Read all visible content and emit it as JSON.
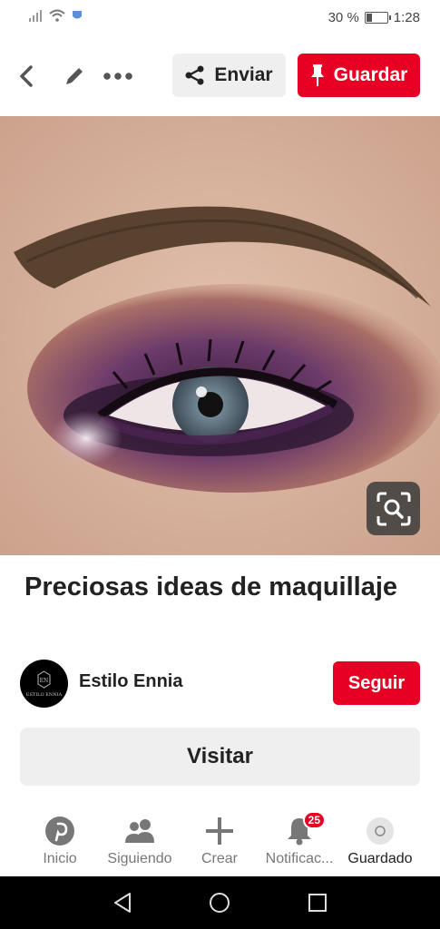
{
  "status_bar": {
    "battery_percent_text": "30 %",
    "battery_level": 0.3,
    "time": "1:28"
  },
  "toolbar": {
    "send_label": "Enviar",
    "save_label": "Guardar",
    "icons": [
      "back-icon",
      "edit-icon",
      "more-icon",
      "share-icon",
      "pin-icon"
    ]
  },
  "pin": {
    "title": "Preciosas ideas de maquillaje",
    "author": {
      "name": "Estilo Ennia",
      "avatar_text": "ESTILO ENNIA",
      "avatar_monogram": "EN"
    },
    "follow_label": "Seguir",
    "visit_label": "Visitar"
  },
  "bottom_nav": {
    "items": [
      {
        "label": "Inicio",
        "icon": "pinterest-icon"
      },
      {
        "label": "Siguiendo",
        "icon": "people-icon"
      },
      {
        "label": "Crear",
        "icon": "plus-icon"
      },
      {
        "label": "Notificac...",
        "icon": "bell-icon",
        "badge": "25"
      },
      {
        "label": "Guardado",
        "icon": "profile-icon"
      }
    ]
  },
  "colors": {
    "accent": "#e60023",
    "button_gray": "#efefef"
  }
}
